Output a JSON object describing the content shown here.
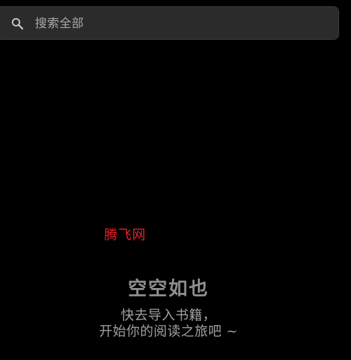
{
  "search": {
    "placeholder": "搜索全部",
    "icon": "search-icon"
  },
  "watermark": {
    "text": "腾飞网"
  },
  "empty_state": {
    "title": "空空如也",
    "line1": "快去导入书籍，",
    "line2": "开始你的阅读之旅吧 ~"
  },
  "colors": {
    "background": "#000000",
    "search_bg": "#2b2b2b",
    "text_muted": "#a0a0a0",
    "title": "#8f8f8f",
    "watermark": "#e8202a"
  }
}
